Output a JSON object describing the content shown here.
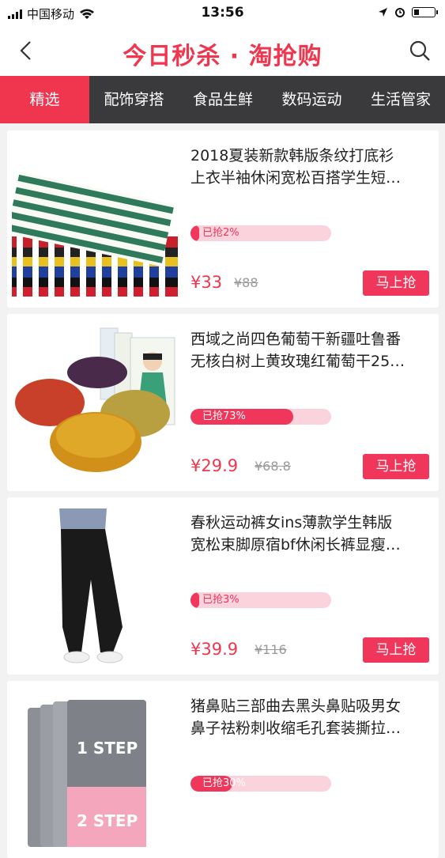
{
  "status_bar": {
    "carrier": "中国移动",
    "time": "13:56"
  },
  "header": {
    "title": "今日秒杀 · 淘抢购"
  },
  "tabs": [
    "精选",
    "配饰穿搭",
    "食品生鲜",
    "数码运动",
    "生活管家"
  ],
  "products": [
    {
      "title": "2018夏装新款韩版条纹打底衫\n上衣半袖休闲宽松百搭学生短…",
      "progress_label": "已抢2%",
      "progress": 0.02,
      "price": "¥33",
      "original_price": "¥88",
      "buy_label": "马上抢"
    },
    {
      "title": "西域之尚四色葡萄干新疆吐鲁番\n无核白树上黄玫瑰红葡萄干25…",
      "progress_label": "已抢73%",
      "progress": 0.73,
      "price": "¥29.9",
      "original_price": "¥68.8",
      "buy_label": "马上抢"
    },
    {
      "title": "春秋运动裤女ins薄款学生韩版\n宽松束脚原宿bf休闲长裤显瘦…",
      "progress_label": "已抢3%",
      "progress": 0.03,
      "price": "¥39.9",
      "original_price": "¥116",
      "buy_label": "马上抢"
    },
    {
      "title": "猪鼻贴三部曲去黑头鼻贴吸男女\n鼻子祛粉刺收缩毛孔套装撕拉…",
      "progress_label": "已抢30%",
      "progress": 0.3,
      "price": "",
      "original_price": "",
      "buy_label": ""
    }
  ],
  "thumb_labels": {
    "step1": "1 STEP",
    "step2": "2 STEP"
  },
  "colors": {
    "accent": "#f0364f",
    "tab_bar": "#3a3a3c",
    "progress_track": "#fbd3dc"
  }
}
